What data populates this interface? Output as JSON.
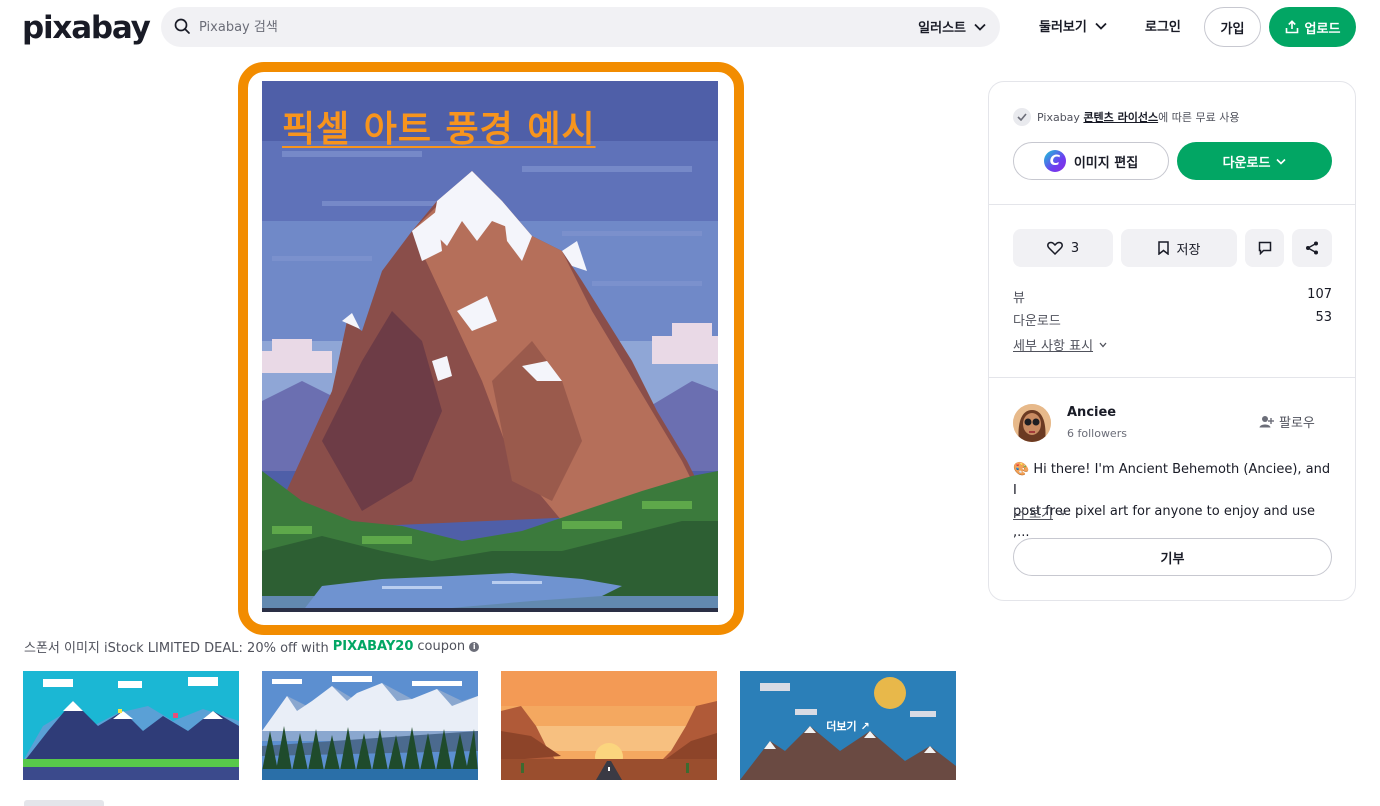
{
  "header": {
    "logo": "pixabay",
    "search_placeholder": "Pixabay 검색",
    "search_type": "일러스트",
    "explore": "둘러보기",
    "login": "로그인",
    "join": "가입",
    "upload": "업로드"
  },
  "image": {
    "overlay_title": "픽셀 아트 풍경 예시",
    "frame_color": "#f28c00"
  },
  "sponsor": {
    "prefix": "스폰서 이미지 iStock LIMITED DEAL: 20% off with",
    "code": "PIXABAY20",
    "suffix": "coupon",
    "more_label": "더보기",
    "thumbnails": [
      {
        "name": "pixel-hills-thumbnail"
      },
      {
        "name": "pixel-snow-mountains-thumbnail"
      },
      {
        "name": "pixel-desert-road-thumbnail"
      },
      {
        "name": "pixel-mountains-sun-thumbnail"
      }
    ]
  },
  "panel": {
    "license_prefix": "Pixabay",
    "license_link": "콘텐츠 라이선스",
    "license_suffix": "에 따른 무료 사용",
    "edit_image": "이미지 편집",
    "download": "다운로드",
    "likes": "3",
    "save": "저장",
    "stats": [
      {
        "label": "뷰",
        "value": "107"
      },
      {
        "label": "다운로드",
        "value": "53"
      }
    ],
    "show_details": "세부 사항 표시",
    "user": {
      "name": "Anciee",
      "followers": "6 followers",
      "follow": "팔로우"
    },
    "bio_line1": "🎨 Hi there! I'm Ancient Behemoth (Anciee), and I",
    "bio_line2": "post free pixel art for anyone to enjoy and use ,...",
    "more": "더 보기",
    "donate": "기부"
  },
  "colors": {
    "brand_green": "#02a664",
    "accent_orange": "#f28c00"
  }
}
